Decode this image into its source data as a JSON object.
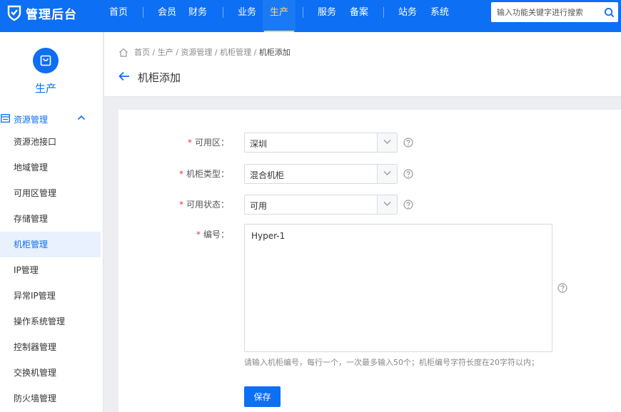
{
  "app": {
    "logo_text": "管理后台"
  },
  "nav": {
    "items": [
      {
        "label": "首页"
      },
      {
        "label": "会员"
      },
      {
        "label": "财务"
      },
      {
        "label": "业务"
      },
      {
        "label": "生产"
      },
      {
        "label": "服务"
      },
      {
        "label": "备案"
      },
      {
        "label": "站务"
      },
      {
        "label": "系统"
      }
    ],
    "active": "生产",
    "search_placeholder": "输入功能关键字进行搜索"
  },
  "sidebar": {
    "module_label": "生产",
    "group_label": "资源管理",
    "items": [
      {
        "label": "资源池接口"
      },
      {
        "label": "地域管理"
      },
      {
        "label": "可用区管理"
      },
      {
        "label": "存储管理"
      },
      {
        "label": "机柜管理",
        "active": true
      },
      {
        "label": "IP管理"
      },
      {
        "label": "异常IP管理"
      },
      {
        "label": "操作系统管理"
      },
      {
        "label": "控制器管理"
      },
      {
        "label": "交换机管理"
      },
      {
        "label": "防火墙管理"
      }
    ]
  },
  "breadcrumb": [
    "首页",
    "生产",
    "资源管理",
    "机柜管理",
    "机柜添加"
  ],
  "page_title": "机柜添加",
  "form": {
    "zone": {
      "label": "可用区：",
      "value": "深圳"
    },
    "cabinet_type": {
      "label": "机柜类型：",
      "value": "混合机柜"
    },
    "status": {
      "label": "可用状态：",
      "value": "可用"
    },
    "number": {
      "label": "编号：",
      "value": "Hyper-1"
    },
    "hint": "请输入机柜编号，每行一个，一次最多输入50个；机柜编号字符长度在20字符以内；",
    "save_label": "保存",
    "required_mark": "*"
  },
  "colors": {
    "primary": "#0d6ff3",
    "nav_active": "#ffd86b",
    "required": "#e4393c"
  }
}
